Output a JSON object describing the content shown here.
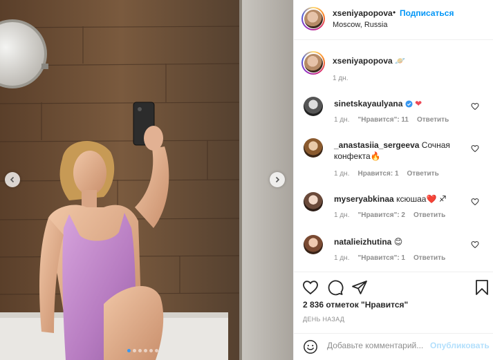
{
  "post": {
    "author": {
      "username": "xseniyapopova",
      "separator": "•",
      "follow_label": "Подписаться",
      "location": "Moscow, Russia"
    },
    "caption": {
      "username": "xseniyapopova",
      "emoji": "🪐",
      "time": "1 дн."
    },
    "carousel": {
      "slide_count": 6,
      "active_slide": 1
    },
    "comments": [
      {
        "username": "sinetskayaulyana",
        "verified": true,
        "text": "❤",
        "time": "1 дн.",
        "likes": "\"Нравится\": 11",
        "reply": "Ответить"
      },
      {
        "username": "_anastasiia_sergeeva",
        "verified": false,
        "text": "Сочная конфекта🔥",
        "time": "1 дн.",
        "likes": "Нравится: 1",
        "reply": "Ответить"
      },
      {
        "username": "myseryabkinaa",
        "verified": false,
        "text": "ксюшаа❤️ ♐",
        "time": "1 дн.",
        "likes": "\"Нравится\": 2",
        "reply": "Ответить"
      },
      {
        "username": "natalieizhutina",
        "verified": false,
        "text": "😊",
        "time": "1 дн.",
        "likes": "\"Нравится\": 1",
        "reply": "Ответить"
      }
    ],
    "likes_text": "2 836 отметок \"Нравится\"",
    "ago_text": "ДЕНЬ НАЗАД",
    "add_comment": {
      "placeholder": "Добавьте комментарий...",
      "publish_label": "Опубликовать"
    },
    "colors": {
      "link_blue": "#0095f6",
      "publish_disabled": "#b2dffc",
      "verified_blue": "#3897f0",
      "muted_text": "#8e8e8e",
      "heart_red": "#ed4956"
    },
    "icons": [
      "chevron-left-icon",
      "chevron-right-icon",
      "heart-outline-icon",
      "comment-icon",
      "share-icon",
      "bookmark-icon",
      "smile-icon",
      "verified-badge-icon"
    ]
  }
}
